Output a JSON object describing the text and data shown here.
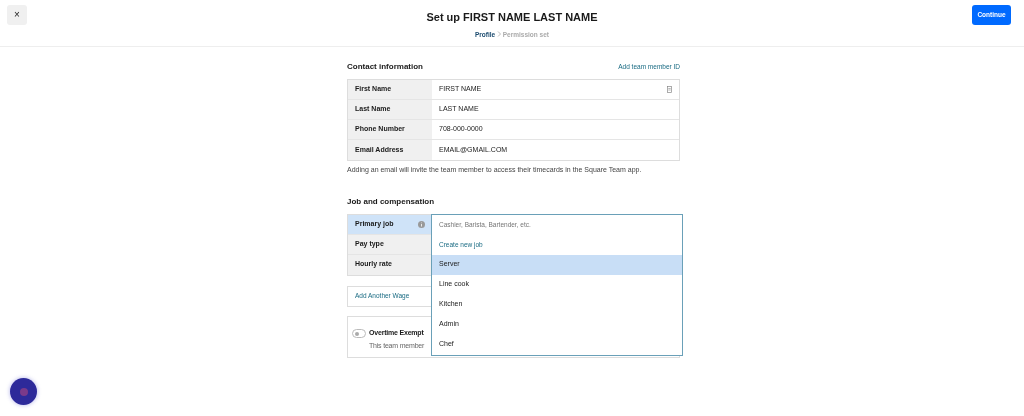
{
  "header": {
    "close": "×",
    "title": "Set up FIRST NAME LAST NAME",
    "continue": "Continue",
    "breadcrumb": [
      {
        "label": "Profile",
        "selected": true
      },
      {
        "label": "Permission set",
        "selected": false
      }
    ]
  },
  "contact": {
    "heading": "Contact information",
    "link": "Add team member ID",
    "rows": [
      {
        "label": "First Name",
        "value": "FIRST NAME",
        "autofill_icon": true
      },
      {
        "label": "Last Name",
        "value": "LAST NAME",
        "autofill_icon": false
      },
      {
        "label": "Phone Number",
        "value": "708-000-0000",
        "autofill_icon": false
      },
      {
        "label": "Email Address",
        "value": "EMAIL@GMAIL.COM",
        "autofill_icon": false
      }
    ],
    "note": "Adding an email will invite the team member to access their timecards in the Square Team app."
  },
  "job": {
    "heading": "Job and compensation",
    "rows": [
      {
        "label": "Primary job",
        "selected": true,
        "info": true
      },
      {
        "label": "Pay type",
        "selected": false,
        "info": false
      },
      {
        "label": "Hourly rate",
        "selected": false,
        "info": false
      }
    ],
    "add_wage": "Add Another Wage",
    "overtime": {
      "label": "Overtime Exempt",
      "description": "This team member",
      "on": false
    }
  },
  "dropdown": {
    "placeholder": "Cashier, Barista, Bartender, etc.",
    "create": "Create new job",
    "options": [
      {
        "label": "Server",
        "selected": true
      },
      {
        "label": "Line cook",
        "selected": false
      },
      {
        "label": "Kitchen",
        "selected": false
      },
      {
        "label": "Admin",
        "selected": false
      },
      {
        "label": "Chef",
        "selected": false
      }
    ]
  }
}
